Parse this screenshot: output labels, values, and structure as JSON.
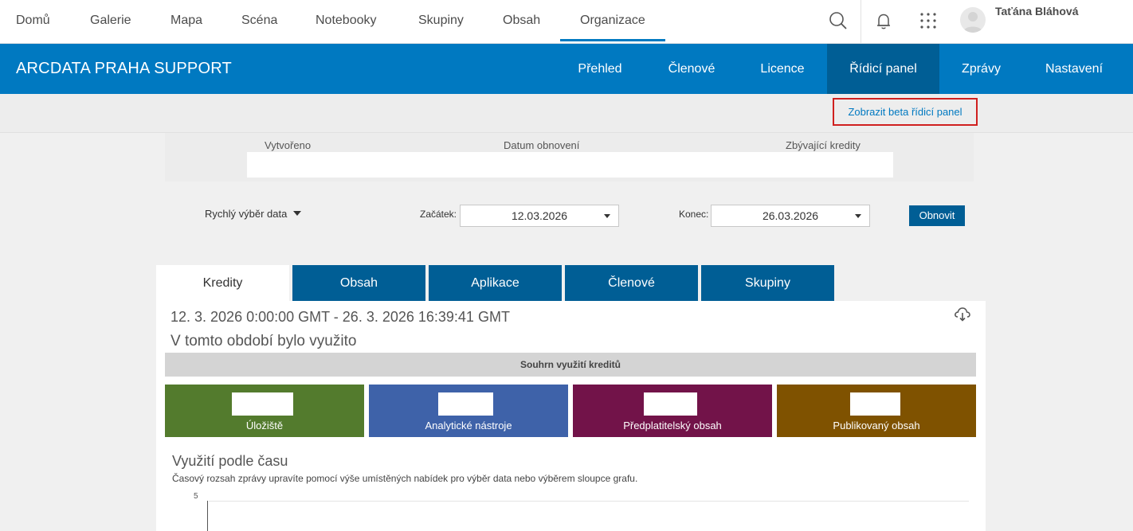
{
  "topnav": {
    "items": [
      "Domů",
      "Galerie",
      "Mapa",
      "Scéna",
      "Notebooky",
      "Skupiny",
      "Obsah",
      "Organizace"
    ],
    "active_index": 7,
    "user": "Taťána Bláhová"
  },
  "org": {
    "name": "ARCDATA PRAHA SUPPORT",
    "nav": [
      "Přehled",
      "Členové",
      "Licence",
      "Řídicí panel",
      "Zprávy",
      "Nastavení"
    ],
    "active_index": 3
  },
  "beta_link": "Zobrazit beta řídicí panel",
  "info": {
    "created_label": "Vytvořeno",
    "renewal_label": "Datum obnovení",
    "credits_label": "Zbývající kredity"
  },
  "dates": {
    "quick_select": "Rychlý výběr data",
    "start_label": "Začátek:",
    "start_value": "12.03.2026",
    "end_label": "Konec:",
    "end_value": "26.03.2026",
    "refresh": "Obnovit"
  },
  "tabs": [
    "Kredity",
    "Obsah",
    "Aplikace",
    "Členové",
    "Skupiny"
  ],
  "panel": {
    "range": "12. 3. 2026 0:00:00 GMT - 26. 3. 2026 16:39:41 GMT",
    "period": "V tomto období bylo využito",
    "summary_title": "Souhrn využití kreditů",
    "cards": [
      {
        "label": "Úložiště",
        "color": "#537b2d"
      },
      {
        "label": "Analytické nástroje",
        "color": "#3e62a9"
      },
      {
        "label": "Předplatitelský obsah",
        "color": "#721349"
      },
      {
        "label": "Publikovaný obsah",
        "color": "#7f5200"
      }
    ],
    "usage_title": "Využití podle času",
    "usage_sub": "Časový rozsah zprávy upravíte pomocí výše umístěných nabídek pro výběr data nebo výběrem sloupce grafu.",
    "y_tick": "5"
  },
  "colors": {
    "brand_blue": "#0079c1",
    "dark_blue": "#005e95",
    "highlight_red": "#d0201f"
  }
}
